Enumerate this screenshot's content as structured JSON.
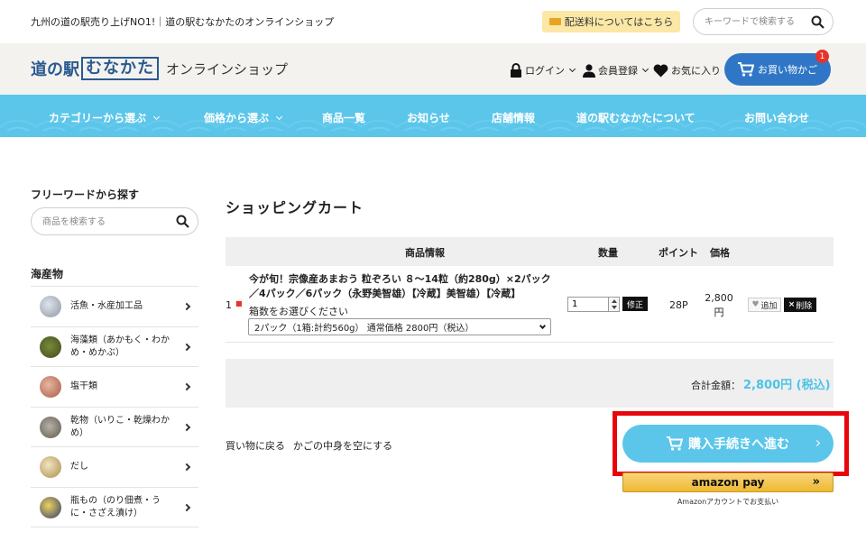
{
  "topbar": {
    "tagline": "九州の道の駅売り上げNO1!｜道の駅むなかたのオンラインショップ",
    "shipping_label": "配送料についてはこちら",
    "search_placeholder": "キーワードで検索する"
  },
  "header": {
    "logo_prefix": "道の駅",
    "logo_name": "むなかた",
    "logo_suffix": "オンラインショップ",
    "login": "ログイン",
    "register": "会員登録",
    "favorites": "お気に入り",
    "cart": "お買い物かご",
    "cart_count": "1"
  },
  "nav": [
    "カテゴリーから選ぶ",
    "価格から選ぶ",
    "商品一覧",
    "お知らせ",
    "店舗情報",
    "道の駅むなかたについて",
    "お問い合わせ"
  ],
  "sidebar": {
    "freeword_title": "フリーワードから探す",
    "search_placeholder": "商品を検索する",
    "section_title": "海産物",
    "categories": [
      "活魚・水産加工品",
      "海藻類（あかもく・わかめ・めかぶ）",
      "塩干類",
      "乾物（いりこ・乾燥わかめ）",
      "だし",
      "瓶もの（のり佃煮・うに・さざえ漬け）"
    ]
  },
  "cart": {
    "title": "ショッピングカート",
    "headers": {
      "product": "商品情報",
      "qty": "数量",
      "points": "ポイント",
      "price": "価格"
    },
    "row": {
      "index": "1",
      "name": "今が旬！宗像産あまおう 粒ぞろい ８～14粒（約280g）×2パック／4パック／6パック（永野美智雄）【冷蔵】美智雄）【冷蔵】",
      "box_label": "箱数をお選びください",
      "option": "2パック（1箱:計約560g） 通常価格 2800円（税込）",
      "qty": "1",
      "fix_label": "修正",
      "points": "28P",
      "price": "2,800円",
      "fav_label": "追加",
      "del_label": "削除"
    },
    "total_label": "合計金額：",
    "total_value": "2,800円 (税込)",
    "back_link": "買い物に戻る",
    "empty_link": "かごの中身を空にする",
    "checkout": "購入手続きへ進む",
    "amazon_label": "amazon pay",
    "amazon_note": "Amazonアカウントでお支払い"
  }
}
